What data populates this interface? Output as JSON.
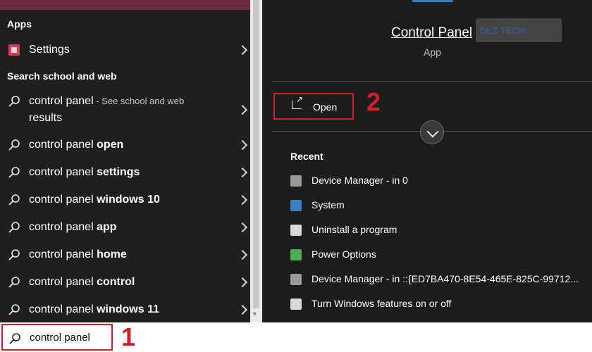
{
  "left_pane": {
    "apps_heading": "Apps",
    "apps": [
      {
        "label": "Settings",
        "icon": "settings-icon"
      }
    ],
    "web_heading": "Search school and web",
    "web_results": [
      {
        "plain": "control panel",
        "bold": "",
        "suffix": " - See school and web",
        "suffix2": "results"
      },
      {
        "plain": "control panel ",
        "bold": "open"
      },
      {
        "plain": "control panel ",
        "bold": "settings"
      },
      {
        "plain": "control panel ",
        "bold": "windows 10"
      },
      {
        "plain": "control panel ",
        "bold": "app"
      },
      {
        "plain": "control panel ",
        "bold": "home"
      },
      {
        "plain": "control panel ",
        "bold": "control"
      },
      {
        "plain": "control panel ",
        "bold": "windows 11"
      }
    ]
  },
  "right_pane": {
    "app_name": "Control Panel",
    "app_type": "App",
    "watermark": "DLZ TECH",
    "open_label": "Open",
    "callout_2": "2",
    "recent_heading": "Recent",
    "recent": [
      {
        "label": "Device Manager - in 0",
        "icon": "device-manager-icon",
        "color": "#9a9a9a"
      },
      {
        "label": "System",
        "icon": "system-icon",
        "color": "#3b82c4"
      },
      {
        "label": "Uninstall a program",
        "icon": "programs-icon",
        "color": "#d9d9d9"
      },
      {
        "label": "Power Options",
        "icon": "power-options-icon",
        "color": "#4caf50"
      },
      {
        "label": "Device Manager - in ::{ED7BA470-8E54-465E-825C-99712...",
        "icon": "device-manager-icon",
        "color": "#9a9a9a"
      },
      {
        "label": "Turn Windows features on or off",
        "icon": "windows-features-icon",
        "color": "#d9d9d9"
      }
    ]
  },
  "search": {
    "value": "control panel",
    "callout_1": "1"
  },
  "colors": {
    "accent_red": "#d21e2b",
    "top_strip": "#6b2a3f"
  }
}
